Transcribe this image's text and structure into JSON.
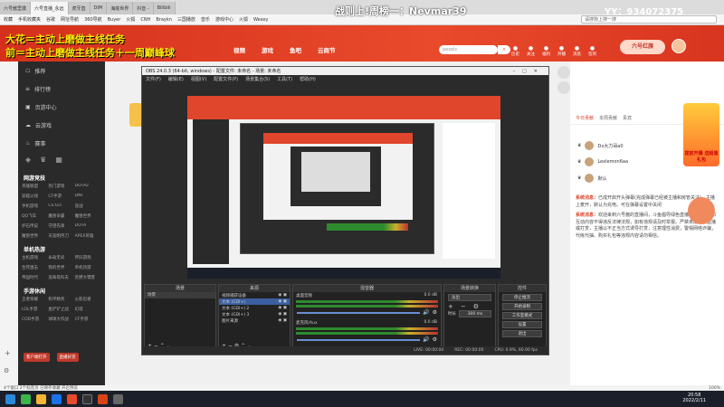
{
  "browser": {
    "tabs": [
      "六号酱里摸",
      "六号直播_永远",
      "虎牙直",
      "DIM",
      "海底世界",
      "抖音 -",
      "Bilibili"
    ],
    "bookmarks": [
      "收藏",
      "手机收藏夹",
      "谷歌",
      "网址导航",
      "360导航",
      "Buyer",
      "火狐",
      "CNH",
      "Braykn",
      "三国播放",
      "音乐",
      "游戏中心",
      "火狐",
      "Weasy"
    ],
    "url_hint": "请搜狗上搜一搜"
  },
  "header": {
    "nav": [
      "视频",
      "游戏",
      "鱼吧",
      "云商节"
    ],
    "search_placeholder": "pexels",
    "icons_labels": [
      "历史",
      "关注",
      "福利",
      "开播",
      "消息",
      "签到"
    ],
    "stream_title": "战则上!周榜一：Nevmar39",
    "yy_id": "YY：934072375",
    "overlay_line1": "大花＝主动上磨做主线任务",
    "overlay_line2": "前＝主动上磨做主线任务＋一周巅峰球"
  },
  "sidebar": {
    "main": [
      "推荐",
      "排行榜",
      "页游中心",
      "云游戏",
      "赛事"
    ],
    "sections": [
      {
        "title": "网游竞技",
        "items": [
          "英雄联盟",
          "热门游戏",
          "DOTA2",
          "穿越火线",
          "CF手游",
          "DNF",
          "手机游戏",
          "CS:GO",
          "逆战",
          "QQ飞车",
          "魔兽争霸",
          "魔兽世界",
          "炉石传说",
          "守望先锋",
          "DOTA",
          "魔兽世界",
          "天涯明月刀",
          "APEX英雄"
        ]
      },
      {
        "title": "单机热游",
        "items": [
          "主机游戏",
          "永劫无间",
          "怀旧游戏",
          "生死狙击",
          "我的世界",
          "单机热游",
          "帝国时代",
          "逃离塔科夫",
          "荒野大镖客"
        ]
      },
      {
        "title": "手游休闲",
        "items": [
          "王者荣耀",
          "和平精英",
          "火影忍者",
          "LOL手游",
          "金铲铲之战",
          "幻塔",
          "COD手游",
          "球球大作战",
          "CF手游"
        ]
      }
    ],
    "btn_left": "客户端打开",
    "btn_right": "直播好货"
  },
  "obs": {
    "title": "OBS 24.0.3 (64-bit, windows) - 配置文件: 未命名 - 场景: 未命名",
    "menu": [
      "文件(F)",
      "编辑(E)",
      "视图(V)",
      "配置文件(P)",
      "场景集合(S)",
      "工具(T)",
      "帮助(H)"
    ],
    "docks": {
      "scenes": {
        "title": "场景",
        "items": [
          "场景"
        ]
      },
      "sources": {
        "title": "来源",
        "items": [
          "视频捕获设备",
          "文本 (GDI+)",
          "文本 (GDI+) 2",
          "文本 (GDI+) 3",
          "图片来源"
        ]
      },
      "mixer": {
        "title": "混音器",
        "channels": [
          {
            "name": "桌面音频",
            "db": "0.0 dB"
          },
          {
            "name": "麦克风/Aux",
            "db": "0.0 dB"
          }
        ]
      },
      "transitions": {
        "title": "场景转换",
        "type": "淡出",
        "duration_label": "时长",
        "duration": "300 ms"
      },
      "controls": {
        "title": "控件",
        "buttons": [
          "停止推流",
          "开始录制",
          "工作室模式",
          "设置",
          "退出"
        ]
      }
    },
    "status": {
      "live": "LIVE: 00:00:00",
      "rec": "REC: 00:00:00",
      "cpu": "CPU: 0.9%, 60.00 fps"
    }
  },
  "chat": {
    "tabs": [
      "今日贡献",
      "本周贡献",
      "贵宾"
    ],
    "rank": [
      {
        "name": "Dx大力哥a0"
      },
      {
        "name": "Lexlemon6aa"
      },
      {
        "name": "默认"
      }
    ],
    "messages": [
      {
        "tag": "系统消息：",
        "text": "已成开启开头弹幕(完成弹幕已经被主播和房管关注)，主播上麦开，默认为充电。可在弹幕设置中关闭"
      },
      {
        "tag": "系统消息：",
        "text": "欢迎来到六号酱的直播间，斗鱼倡导绿色直播，直播内容和互动内容不得违反法律法规，如有违规请及时举报。严禁未成年人直播或打赏，主播以不正当方式诱导打赏，注意理性消费，警惕网络诈骗，代练代抽、购买礼包等违规内容请勿相信。"
      }
    ],
    "promo": "提前开播 送超值礼包"
  },
  "statusline": {
    "left": "4个窗口  2个标签页 已保存收藏 开启预览",
    "right": "100%"
  },
  "taskbar": {
    "time": "20:58",
    "date": "2022/2/11"
  },
  "colors": {
    "accent": "#e94a2b",
    "obs_bg": "#2b2b2b",
    "taskbar": "#1a1f2a"
  }
}
